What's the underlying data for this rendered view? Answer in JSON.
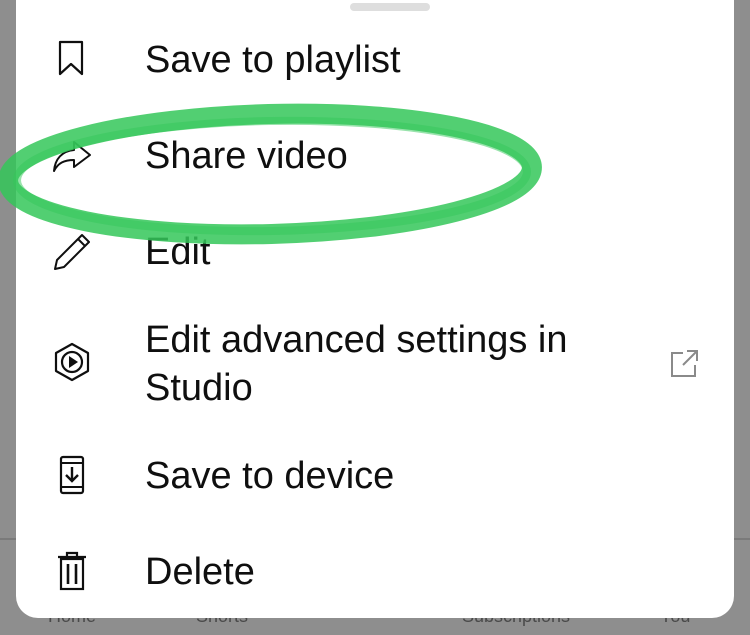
{
  "background": {
    "nav_labels": [
      "Home",
      "Shorts",
      "Subscriptions",
      "You"
    ]
  },
  "menu": {
    "items": [
      {
        "label": "Save to playlist",
        "icon": "bookmark-icon"
      },
      {
        "label": "Share video",
        "icon": "share-icon"
      },
      {
        "label": "Edit",
        "icon": "pencil-icon"
      },
      {
        "label_line1": "Edit advanced settings in",
        "label_line2": "Studio",
        "icon": "studio-icon",
        "trailing_icon": "external-link-icon"
      },
      {
        "label": "Save to device",
        "icon": "download-device-icon"
      },
      {
        "label": "Delete",
        "icon": "trash-icon"
      }
    ]
  },
  "annotation": {
    "color": "#34c759",
    "target": "Share video"
  }
}
